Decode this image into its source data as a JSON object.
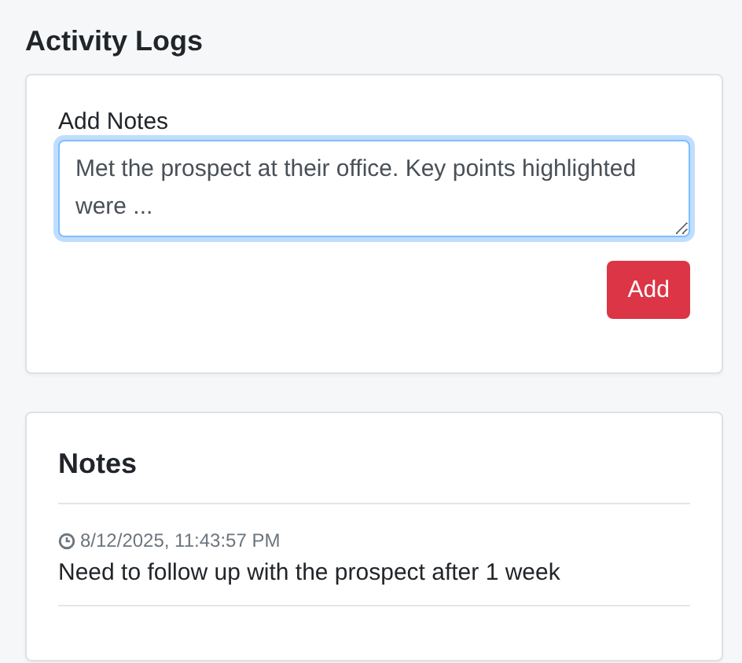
{
  "title": "Activity Logs",
  "add_notes": {
    "label": "Add Notes",
    "value": "Met the prospect at their office. Key points highlighted were ...",
    "focused": true,
    "button": "Add"
  },
  "notes": {
    "heading": "Notes",
    "items": [
      {
        "timestamp": "8/12/2025, 11:43:57 PM",
        "text": "Need to follow up with the prospect after 1 week"
      }
    ]
  }
}
